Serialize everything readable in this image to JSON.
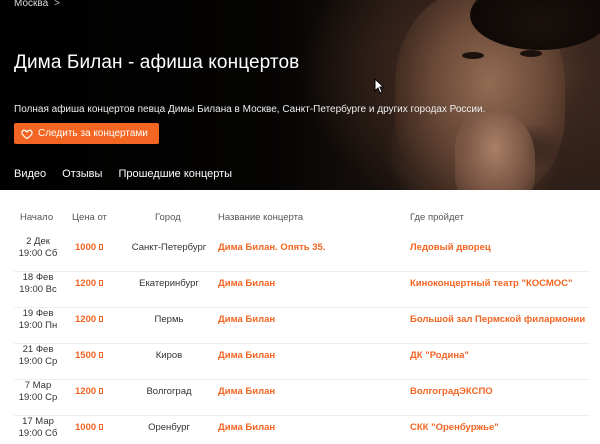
{
  "breadcrumb": {
    "city": "Москва",
    "separator": ">"
  },
  "title": "Дима Билан - афиша концертов",
  "description": "Полная афиша концертов певца Димы Билана в Москве, Санкт-Петербурге и других городах России.",
  "follow_button": {
    "label": "Следить за концертами",
    "icon": "heart-icon"
  },
  "tabs": [
    {
      "label": "Видео"
    },
    {
      "label": "Отзывы"
    },
    {
      "label": "Прошедшие концерты"
    }
  ],
  "table": {
    "headers": {
      "start": "Начало",
      "price": "Цена от",
      "city": "Город",
      "concert": "Название концерта",
      "venue": "Где пройдет"
    },
    "rows": [
      {
        "date": "2 Дек",
        "time": "19:00 Сб",
        "price": "1000",
        "city": "Санкт-Петербург",
        "concert": "Дима Билан. Опять 35.",
        "venue": "Ледовый дворец"
      },
      {
        "date": "18 Фев",
        "time": "19:00 Вс",
        "price": "1200",
        "city": "Екатеринбург",
        "concert": "Дима Билан",
        "venue": "Киноконцертный театр \"КОСМОС\""
      },
      {
        "date": "19 Фев",
        "time": "19:00 Пн",
        "price": "1200",
        "city": "Пермь",
        "concert": "Дима Билан",
        "venue": "Большой зал Пермской филармонии"
      },
      {
        "date": "21 Фев",
        "time": "19:00 Ср",
        "price": "1500",
        "city": "Киров",
        "concert": "Дима Билан",
        "venue": "ДК \"Родина\""
      },
      {
        "date": "7 Мар",
        "time": "19:00 Ср",
        "price": "1200",
        "city": "Волгоград",
        "concert": "Дима Билан",
        "venue": "ВолгоградЭКСПО"
      },
      {
        "date": "17 Мар",
        "time": "19:00 Сб",
        "price": "1000",
        "city": "Оренбург",
        "concert": "Дима Билан",
        "venue": "СКК \"Оренбуржье\""
      }
    ]
  },
  "colors": {
    "accent": "#f26522",
    "hero_bg": "#000000"
  }
}
